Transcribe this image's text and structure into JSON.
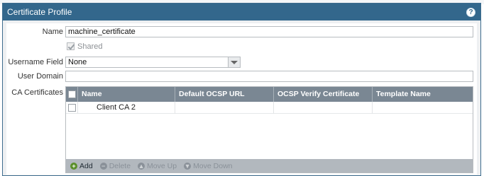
{
  "dialog": {
    "title": "Certificate Profile",
    "help_icon_glyph": "?"
  },
  "form": {
    "name_label": "Name",
    "name_value": "machine_certificate",
    "shared_label": "Shared",
    "shared_checked": true,
    "username_field_label": "Username Field",
    "username_field_value": "None",
    "user_domain_label": "User Domain",
    "user_domain_value": "",
    "ca_certificates_label": "CA Certificates"
  },
  "grid": {
    "columns": [
      "Name",
      "Default OCSP URL",
      "OCSP Verify Certificate",
      "Template Name"
    ],
    "rows": [
      {
        "name": "Client CA 2",
        "default_ocsp_url": "",
        "ocsp_verify_certificate": "",
        "template_name": ""
      }
    ],
    "toolbar": {
      "add": "Add",
      "delete": "Delete",
      "move_up": "Move Up",
      "move_down": "Move Down"
    }
  },
  "colors": {
    "titlebar": "#33678c",
    "grid_header": "#7a8793",
    "toolbar": "#b2b8be"
  }
}
